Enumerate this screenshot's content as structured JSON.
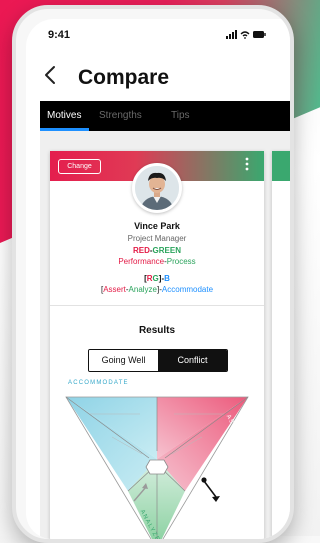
{
  "status_bar": {
    "time": "9:41",
    "icons": "signal wifi battery"
  },
  "nav": {
    "back_icon": "chevron-left-icon",
    "title": "Compare"
  },
  "tabs": [
    {
      "label": "Motives",
      "active": true
    },
    {
      "label": "Strengths",
      "active": false
    },
    {
      "label": "Tips",
      "active": false
    }
  ],
  "profile": {
    "change_label": "Change",
    "name": "Vince Park",
    "role": "Project Manager",
    "combo_first": "RED",
    "combo_sep": "-",
    "combo_second": "GREEN",
    "combo_desc_first": "Performance",
    "combo_desc_sep": "-",
    "combo_desc_second": "Process",
    "code_open": "[",
    "code_r": "R",
    "code_g": "G",
    "code_close": "]",
    "code_sep": "-",
    "code_b": "B",
    "code_sub_open": "[",
    "code_sub_assert": "Assert",
    "code_sub_sep1": "-",
    "code_sub_analyze": "Analyze",
    "code_sub_close": "]",
    "code_sub_sep2": "-",
    "code_sub_accommodate": "Accommodate"
  },
  "results": {
    "title": "Results",
    "options": [
      "Going Well",
      "Conflict"
    ],
    "selected": "Conflict"
  },
  "triangle": {
    "label_accommodate": "ACCOMMODATE",
    "label_assert": "ASSERT",
    "label_analyze": "ANALYZE"
  },
  "colors": {
    "red": "#e31b46",
    "green": "#2aa35c",
    "blue": "#1e90ff"
  }
}
